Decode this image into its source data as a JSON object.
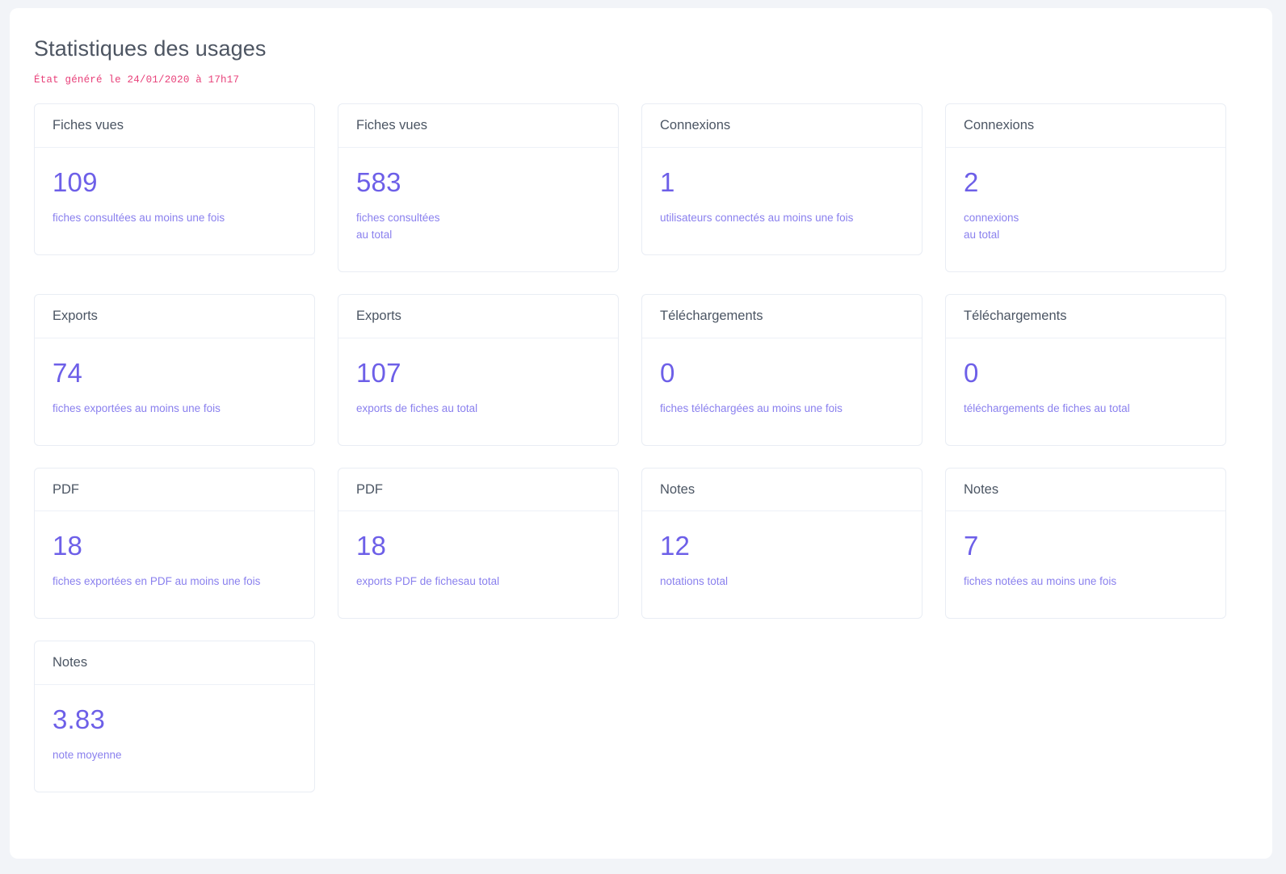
{
  "page": {
    "title": "Statistiques des usages",
    "generated_note": "État généré le 24/01/2020 à 17h17",
    "accent_color": "#6d5fe8",
    "label_color": "#8a80ee",
    "note_color": "#e8417a",
    "title_color": "#4d5562",
    "card_border_color": "#e9edf4",
    "background_color": "#f2f4f8"
  },
  "cards": [
    {
      "title": "Fiches vues",
      "value": "109",
      "label": "fiches consultées au moins une fois"
    },
    {
      "title": "Fiches vues",
      "value": "583",
      "label": "fiches consultées\nau total"
    },
    {
      "title": "Connexions",
      "value": "1",
      "label": "utilisateurs connectés au moins une fois"
    },
    {
      "title": "Connexions",
      "value": "2",
      "label": "connexions\nau total"
    },
    {
      "title": "Exports",
      "value": "74",
      "label": "fiches exportées au moins une fois"
    },
    {
      "title": "Exports",
      "value": "107",
      "label": "exports de fiches au total"
    },
    {
      "title": "Téléchargements",
      "value": "0",
      "label": "fiches téléchargées au moins une fois"
    },
    {
      "title": "Téléchargements",
      "value": "0",
      "label": "téléchargements de fiches au total"
    },
    {
      "title": "PDF",
      "value": "18",
      "label": "fiches exportées en PDF au moins une fois"
    },
    {
      "title": "PDF",
      "value": "18",
      "label": "exports PDF de fichesau total"
    },
    {
      "title": "Notes",
      "value": "12",
      "label": "notations total"
    },
    {
      "title": "Notes",
      "value": "7",
      "label": "fiches notées au moins une fois"
    },
    {
      "title": "Notes",
      "value": "3.83",
      "label": "note moyenne"
    }
  ]
}
